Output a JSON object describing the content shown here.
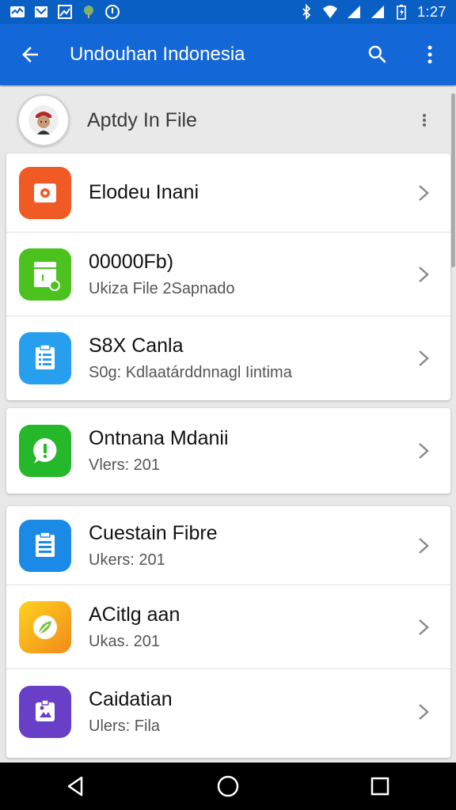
{
  "status_bar": {
    "time": "1:27",
    "left_icons": [
      "activity-icon",
      "mail-icon",
      "gallery-icon",
      "tree-icon",
      "download-icon"
    ],
    "right_icons": [
      "bluetooth-icon",
      "wifi-icon",
      "signal-icon",
      "signal-icon",
      "battery-icon"
    ]
  },
  "app_bar": {
    "title": "Undouhan Indonesia",
    "back_icon": "arrow-back-icon",
    "search_icon": "search-icon",
    "more_icon": "more-vert-icon",
    "color": "#1467d6"
  },
  "profile": {
    "name": "Aptdy In File"
  },
  "cards": [
    {
      "items": [
        {
          "title": "Elodeu Inani",
          "subtitle": "",
          "icon": "camera-icon",
          "color": "#f05a24"
        },
        {
          "title": "00000Fb)",
          "subtitle": "Ukiza File 2Sapnado",
          "icon": "file-icon",
          "color": "#4cc21f"
        },
        {
          "title": "S8X Canla",
          "subtitle": "S0g: Kdlaatárddnnagl Iintima",
          "icon": "document-icon",
          "color": "#26a0ee"
        }
      ]
    },
    {
      "items": [
        {
          "title": "Ontnana Mdanii",
          "subtitle": "Vlers: 201",
          "icon": "chat-icon",
          "color": "#25b82a"
        }
      ]
    },
    {
      "items": [
        {
          "title": "Cuestain Fibre",
          "subtitle": "Ukers: 201",
          "icon": "list-icon",
          "color": "#1b8ae6"
        },
        {
          "title": "ACitlg aan",
          "subtitle": "Ukas. 201",
          "icon": "leaf-icon",
          "color": "#f8a81c"
        },
        {
          "title": "Caidatian",
          "subtitle": "Ulers: Fila",
          "icon": "photo-icon",
          "color": "#6a3fc8"
        }
      ]
    }
  ]
}
